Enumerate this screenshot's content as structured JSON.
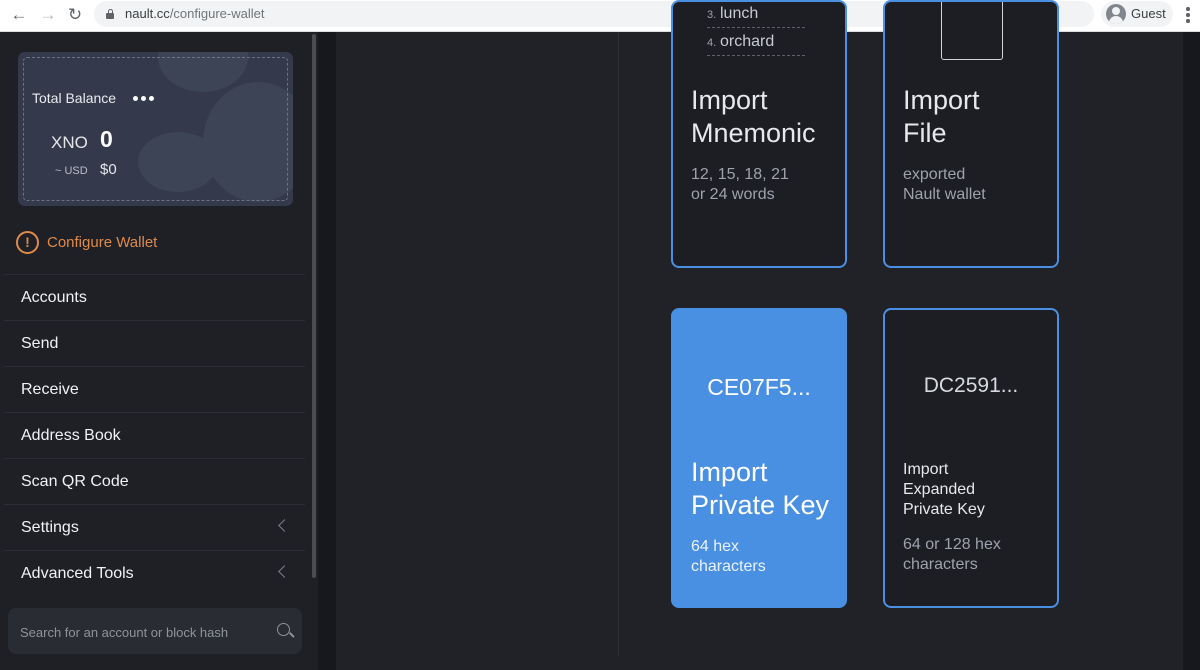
{
  "browser": {
    "url_host": "nault.cc",
    "url_path": "/configure-wallet",
    "profile_name": "Guest"
  },
  "sidebar": {
    "balance": {
      "label": "Total Balance",
      "unit": "XNO",
      "value": "0",
      "fiat_label": "~ USD",
      "fiat_value": "$0"
    },
    "configure_label": "Configure Wallet",
    "menu": [
      {
        "label": "Accounts"
      },
      {
        "label": "Send"
      },
      {
        "label": "Receive"
      },
      {
        "label": "Address Book"
      },
      {
        "label": "Scan QR Code"
      },
      {
        "label": "Settings"
      },
      {
        "label": "Advanced Tools"
      }
    ],
    "search_placeholder": "Search for an account or block hash"
  },
  "cards": {
    "mnemonic": {
      "words": [
        {
          "num": "3.",
          "word": "lunch"
        },
        {
          "num": "4.",
          "word": "orchard"
        }
      ],
      "title_1": "Import",
      "title_2": "Mnemonic",
      "sub_1": "12, 15, 18, 21",
      "sub_2": "or 24 words"
    },
    "file": {
      "title_1": "Import",
      "title_2": "File",
      "sub_1": "exported",
      "sub_2": "Nault wallet"
    },
    "private_key": {
      "hex": "CE07F5...",
      "title_1": "Import",
      "title_2": "Private Key",
      "sub_1": "64 hex",
      "sub_2": "characters"
    },
    "expanded_key": {
      "hex": "DC2591...",
      "title_1": "Import",
      "title_2": "Expanded",
      "title_3": "Private Key",
      "sub_1": "64 or 128 hex",
      "sub_2": "characters"
    }
  },
  "colors": {
    "accent": "#4a90e2",
    "warning": "#e08a4a",
    "sidebar_bg": "#1e2026",
    "main_bg": "#212227"
  }
}
